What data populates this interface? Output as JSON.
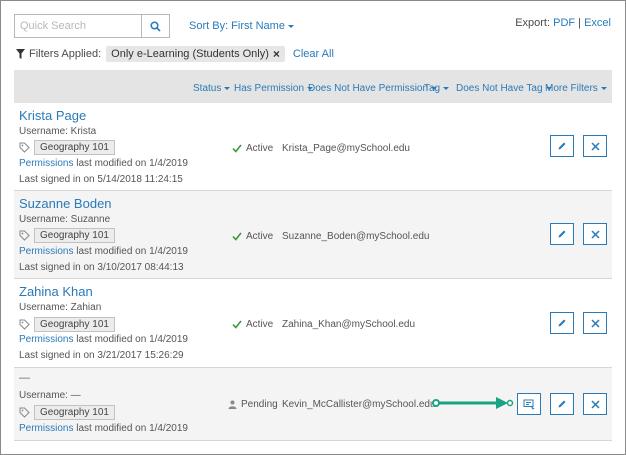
{
  "search": {
    "placeholder": "Quick Search",
    "value": ""
  },
  "sort": {
    "label": "Sort By: First Name"
  },
  "export": {
    "label": "Export:",
    "pdf": "PDF",
    "sep": "|",
    "excel": "Excel"
  },
  "filters": {
    "label": "Filters Applied:",
    "chip": "Only e-Learning (Students Only)",
    "clear": "Clear All"
  },
  "headers": [
    "Status",
    "Has Permission",
    "Does Not Have Permission",
    "Tag",
    "Does Not Have Tag",
    "More Filters"
  ],
  "rows": [
    {
      "name": "Krista Page",
      "username": "Username: Krista",
      "tag": "Geography 101",
      "perm_link": "Permissions",
      "perm_text": " last modified on 1/4/2019",
      "signin": "Last signed in on 5/14/2018 11:24:15",
      "status": "Active",
      "email": "Krista_Page@mySchool.edu"
    },
    {
      "name": "Suzanne Boden",
      "username": "Username: Suzanne",
      "tag": "Geography 101",
      "perm_link": "Permissions",
      "perm_text": " last modified on 1/4/2019",
      "signin": "Last signed in on 3/10/2017 08:44:13",
      "status": "Active",
      "email": "Suzanne_Boden@mySchool.edu"
    },
    {
      "name": "Zahina Khan",
      "username": "Username: Zahian",
      "tag": "Geography 101",
      "perm_link": "Permissions",
      "perm_text": " last modified on 1/4/2019",
      "signin": "Last signed in on 3/21/2017 15:26:29",
      "status": "Active",
      "email": "Zahina_Khan@mySchool.edu"
    },
    {
      "name": "—",
      "username": "Username: —",
      "tag": "Geography 101",
      "perm_link": "Permissions",
      "perm_text": " last modified on 1/4/2019",
      "status": "Pending",
      "email": "Kevin_McCallister@mySchool.edu"
    }
  ],
  "icons": {
    "search": "search-icon",
    "filter": "funnel-icon",
    "tag": "tag-icon",
    "active": "checkmark-icon",
    "pending": "person-icon",
    "edit": "pencil-icon",
    "delete": "close-icon",
    "resend": "resend-invite-icon"
  },
  "colors": {
    "accent": "#2a7ab8",
    "arrow": "#1aa383",
    "header": "#e4e4e4"
  }
}
